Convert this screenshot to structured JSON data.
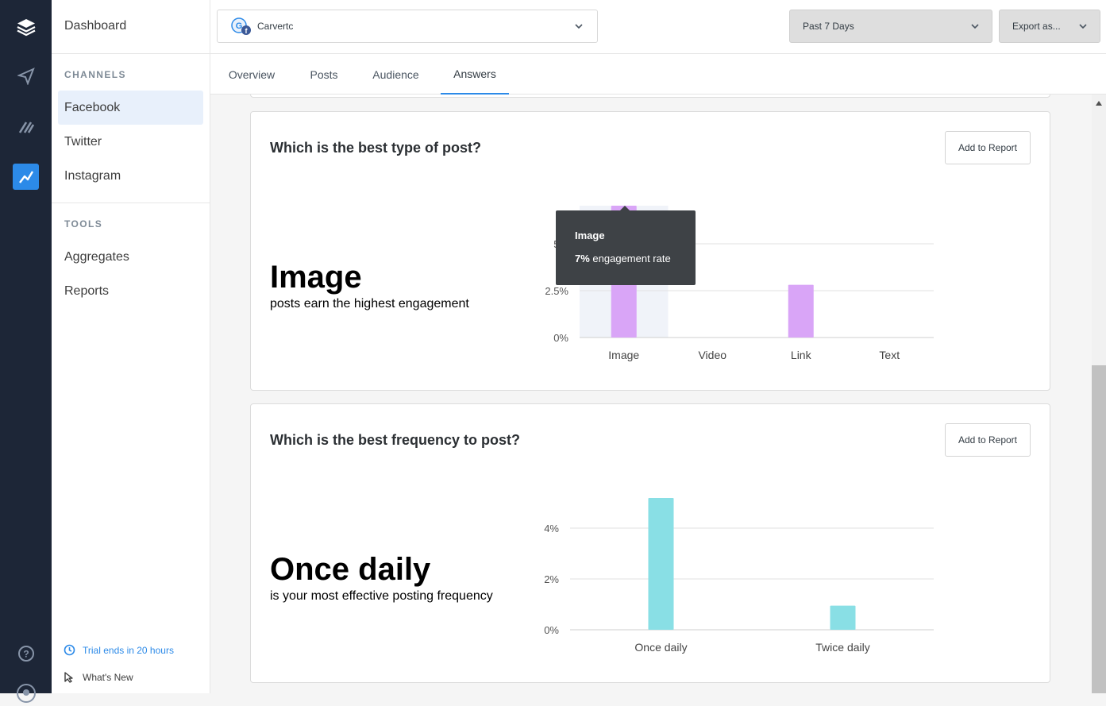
{
  "nav": {
    "dashboard": "Dashboard",
    "channels_heading": "CHANNELS",
    "channels": [
      "Facebook",
      "Twitter",
      "Instagram"
    ],
    "tools_heading": "TOOLS",
    "tools": [
      "Aggregates",
      "Reports"
    ],
    "trial": "Trial ends in 20 hours",
    "whats_new": "What's New"
  },
  "header": {
    "account": "Carvertc",
    "date_range": "Past 7 Days",
    "export": "Export as..."
  },
  "tabs": [
    "Overview",
    "Posts",
    "Audience",
    "Answers"
  ],
  "active_tab": "Answers",
  "cards": [
    {
      "question": "Which is the best type of post?",
      "add_label": "Add to Report",
      "answer": "Image",
      "answer_sub": "posts earn the highest engagement"
    },
    {
      "question": "Which is the best frequency to post?",
      "add_label": "Add to Report",
      "answer": "Once daily",
      "answer_sub": "is your most effective posting frequency"
    }
  ],
  "tooltip": {
    "title": "Image",
    "value": "7%",
    "suffix": " engagement rate"
  },
  "colors": {
    "rail_bg": "#1d2637",
    "accent": "#2c8ae8",
    "type_bar": "#d9a5f7",
    "freq_bar": "#89dfe5"
  },
  "chart_data": [
    {
      "type": "bar",
      "categories": [
        "Image",
        "Video",
        "Link",
        "Text"
      ],
      "values": [
        7,
        0,
        2.8,
        0
      ],
      "yticks": [
        "0%",
        "2.5%",
        "5%"
      ],
      "ylim": [
        0,
        7
      ],
      "grid": true,
      "highlighted": "Image"
    },
    {
      "type": "bar",
      "categories": [
        "Once daily",
        "Twice daily"
      ],
      "values": [
        5.2,
        0.95
      ],
      "yticks": [
        "0%",
        "2%",
        "4%"
      ],
      "ylim": [
        0,
        5.2
      ],
      "grid": true
    }
  ]
}
